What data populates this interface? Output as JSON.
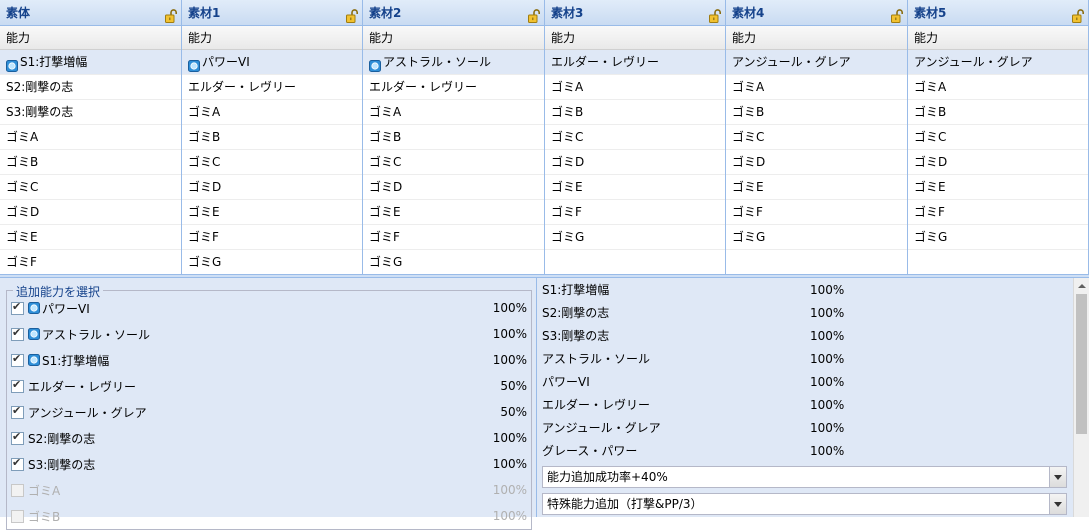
{
  "grids": [
    {
      "title": "素体",
      "header": "能力",
      "rows": [
        {
          "text": "S1:打撃増幅",
          "gem": true,
          "selected": true
        },
        {
          "text": "S2:剛撃の志"
        },
        {
          "text": "S3:剛撃の志"
        },
        {
          "text": "ゴミA"
        },
        {
          "text": "ゴミB"
        },
        {
          "text": "ゴミC"
        },
        {
          "text": "ゴミD"
        },
        {
          "text": "ゴミE"
        },
        {
          "text": "ゴミF"
        }
      ]
    },
    {
      "title": "素材1",
      "header": "能力",
      "rows": [
        {
          "text": "パワーVI",
          "gem": true,
          "selected": true
        },
        {
          "text": "エルダー・レヴリー"
        },
        {
          "text": "ゴミA"
        },
        {
          "text": "ゴミB"
        },
        {
          "text": "ゴミC"
        },
        {
          "text": "ゴミD"
        },
        {
          "text": "ゴミE"
        },
        {
          "text": "ゴミF"
        },
        {
          "text": "ゴミG"
        }
      ]
    },
    {
      "title": "素材2",
      "header": "能力",
      "rows": [
        {
          "text": "アストラル・ソール",
          "gem": true,
          "selected": true
        },
        {
          "text": "エルダー・レヴリー"
        },
        {
          "text": "ゴミA"
        },
        {
          "text": "ゴミB"
        },
        {
          "text": "ゴミC"
        },
        {
          "text": "ゴミD"
        },
        {
          "text": "ゴミE"
        },
        {
          "text": "ゴミF"
        },
        {
          "text": "ゴミG"
        }
      ]
    },
    {
      "title": "素材3",
      "header": "能力",
      "rows": [
        {
          "text": "エルダー・レヴリー",
          "selected": true
        },
        {
          "text": "ゴミA"
        },
        {
          "text": "ゴミB"
        },
        {
          "text": "ゴミC"
        },
        {
          "text": "ゴミD"
        },
        {
          "text": "ゴミE"
        },
        {
          "text": "ゴミF"
        },
        {
          "text": "ゴミG"
        }
      ]
    },
    {
      "title": "素材4",
      "header": "能力",
      "rows": [
        {
          "text": "アンジュール・グレア",
          "selected": true
        },
        {
          "text": "ゴミA"
        },
        {
          "text": "ゴミB"
        },
        {
          "text": "ゴミC"
        },
        {
          "text": "ゴミD"
        },
        {
          "text": "ゴミE"
        },
        {
          "text": "ゴミF"
        },
        {
          "text": "ゴミG"
        }
      ]
    },
    {
      "title": "素材5",
      "header": "能力",
      "rows": [
        {
          "text": "アンジュール・グレア",
          "selected": true
        },
        {
          "text": "ゴミA"
        },
        {
          "text": "ゴミB"
        },
        {
          "text": "ゴミC"
        },
        {
          "text": "ゴミD"
        },
        {
          "text": "ゴミE"
        },
        {
          "text": "ゴミF"
        },
        {
          "text": "ゴミG"
        }
      ]
    }
  ],
  "select_panel": {
    "legend": "追加能力を選択",
    "options": [
      {
        "label": "パワーVI",
        "gem": true,
        "checked": true,
        "pct": "100%"
      },
      {
        "label": "アストラル・ソール",
        "gem": true,
        "checked": true,
        "pct": "100%"
      },
      {
        "label": "S1:打撃増幅",
        "gem": true,
        "checked": true,
        "pct": "100%"
      },
      {
        "label": "エルダー・レヴリー",
        "checked": true,
        "pct": "50%"
      },
      {
        "label": "アンジュール・グレア",
        "checked": true,
        "pct": "50%"
      },
      {
        "label": "S2:剛撃の志",
        "checked": true,
        "pct": "100%"
      },
      {
        "label": "S3:剛撃の志",
        "checked": true,
        "pct": "100%"
      },
      {
        "label": "ゴミA",
        "checked": false,
        "disabled": true,
        "pct": "100%"
      },
      {
        "label": "ゴミB",
        "checked": false,
        "disabled": true,
        "pct": "100%"
      }
    ]
  },
  "results": [
    {
      "name": "S1:打撃増幅",
      "value": "100%"
    },
    {
      "name": "S2:剛撃の志",
      "value": "100%"
    },
    {
      "name": "S3:剛撃の志",
      "value": "100%"
    },
    {
      "name": "アストラル・ソール",
      "value": "100%"
    },
    {
      "name": "パワーVI",
      "value": "100%"
    },
    {
      "name": "エルダー・レヴリー",
      "value": "100%"
    },
    {
      "name": "アンジュール・グレア",
      "value": "100%"
    },
    {
      "name": "グレース・パワー",
      "value": "100%"
    }
  ],
  "combos": [
    {
      "value": "能力追加成功率+40%"
    },
    {
      "value": "特殊能力追加（打撃&PP/3）"
    }
  ],
  "icons": {
    "lock": "lock-open-icon",
    "gem": "gem-icon"
  },
  "colors": {
    "header_text": "#15428b",
    "selected_row": "#dfe8f6",
    "panel_bg": "#dfe8f6",
    "border": "#99bbe8"
  }
}
